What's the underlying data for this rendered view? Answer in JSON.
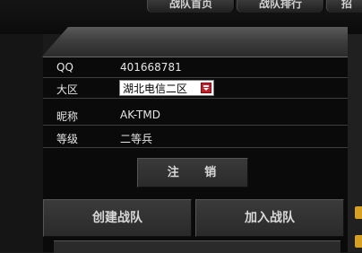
{
  "top_tabs": [
    "战队首页",
    "战队排行",
    "招"
  ],
  "profile": {
    "qq_label": "QQ",
    "qq_value": "401668781",
    "region_label": "大区",
    "region_value": "湖北电信二区",
    "nickname_label": "昵称",
    "nickname_value": "AK-TMD",
    "rank_label": "等级",
    "rank_value": "二等兵"
  },
  "buttons": {
    "logout": "注 销",
    "create_team": "创建战队",
    "join_team": "加入战队"
  },
  "colors": {
    "accent_orange": "#d8a021",
    "dropdown_red": "#c4202a"
  }
}
